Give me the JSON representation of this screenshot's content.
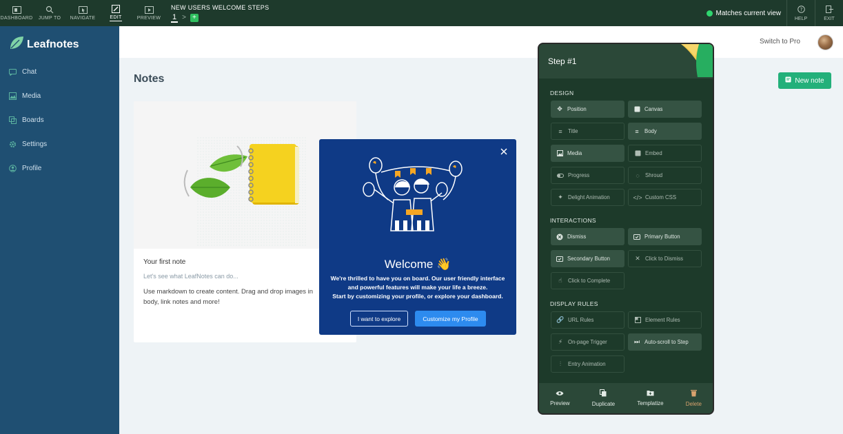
{
  "toolbar": {
    "dashboard": "DASHBOARD",
    "jump_to": "JUMP TO",
    "navigate": "NAVIGATE",
    "edit": "EDIT",
    "preview": "PREVIEW",
    "flow_title": "NEW USERS WELCOME STEPS",
    "step_number": "1",
    "add": "+",
    "match_status": "Matches current view",
    "help": "HELP",
    "exit": "EXIT"
  },
  "sidebar": {
    "logo": "Leafnotes",
    "items": [
      {
        "label": "Chat",
        "icon": "chat-icon"
      },
      {
        "label": "Media",
        "icon": "media-icon"
      },
      {
        "label": "Boards",
        "icon": "boards-icon"
      },
      {
        "label": "Settings",
        "icon": "settings-icon"
      },
      {
        "label": "Profile",
        "icon": "profile-icon"
      }
    ]
  },
  "header": {
    "switch_pro": "Switch to Pro"
  },
  "main": {
    "title": "Notes",
    "new_note": "New note",
    "card": {
      "title": "Your first note",
      "subtitle": "Let's see what LeafNotes can do...",
      "text": "Use markdown to create content. Drag and drop images in body, link notes and more!"
    }
  },
  "modal": {
    "title": "Welcome 👋",
    "line1": "We're thrilled to have you on board. Our user friendly interface",
    "line2": "and powerful features will make your life a breeze.",
    "line3": "Start by customizing your profile, or explore your dashboard.",
    "explore": "I want to explore",
    "customize": "Customize my Profile"
  },
  "panel": {
    "title": "Step #1",
    "design_label": "DESIGN",
    "design": [
      "Position",
      "Canvas",
      "Title",
      "Body",
      "Media",
      "Embed",
      "Progress",
      "Shroud",
      "Delight Animation",
      "Custom CSS"
    ],
    "interactions_label": "INTERACTIONS",
    "interactions": [
      "Dismiss",
      "Primary Button",
      "Secondary Button",
      "Click to Dismiss",
      "Click to Complete"
    ],
    "rules_label": "DISPLAY RULES",
    "rules": [
      "URL Rules",
      "Element Rules",
      "On-page Trigger",
      "Auto-scroll to Step",
      "Entry Animation"
    ],
    "footer": [
      "Preview",
      "Duplicate",
      "Templatize",
      "Delete"
    ]
  },
  "colors": {
    "toolbar_bg": "#1e3a2c",
    "sidebar_bg": "#1f4f72",
    "modal_bg": "#0f3a86",
    "panel_bg": "#1d3a2a",
    "accent_green": "#23b07a",
    "primary_blue": "#2d8bef"
  }
}
